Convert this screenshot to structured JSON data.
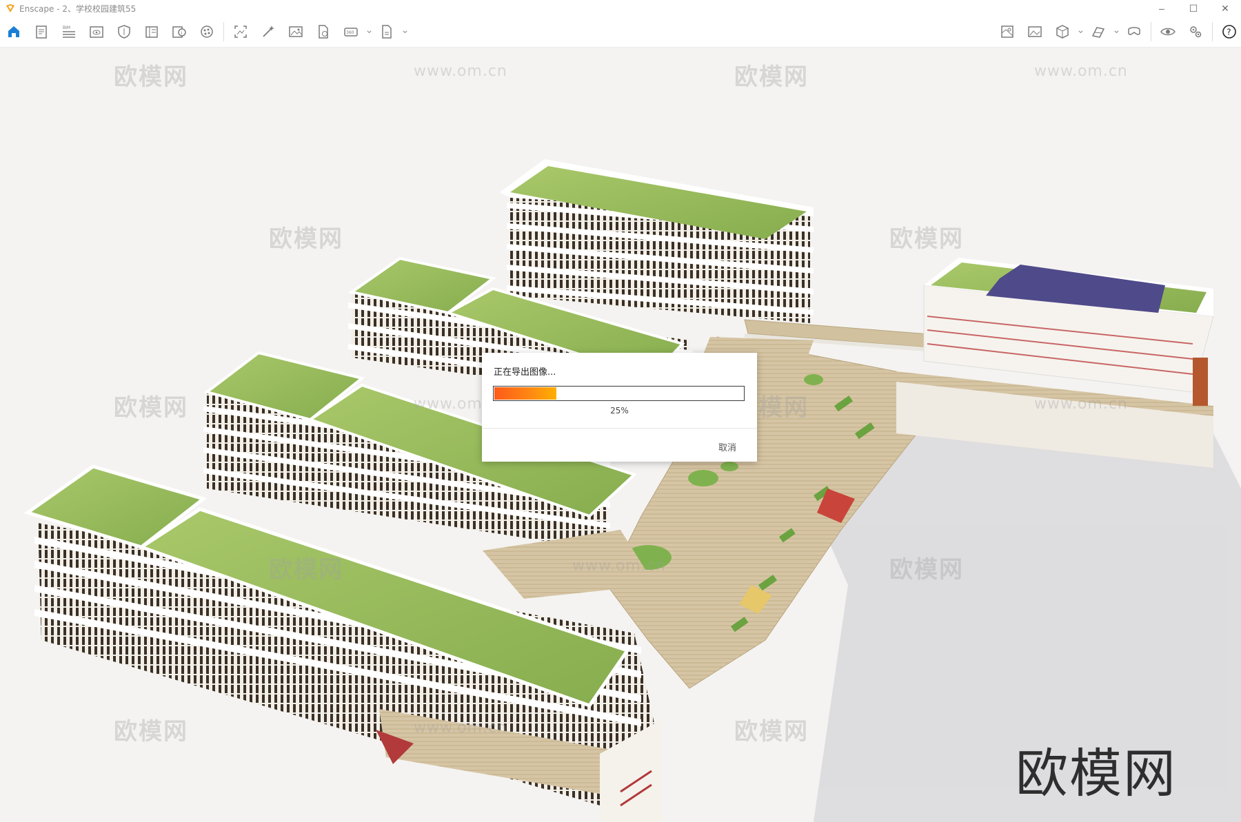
{
  "window": {
    "title": "Enscape - 2、学校校园建筑55",
    "controls": {
      "minimize": "–",
      "maximize": "☐",
      "close": "✕"
    }
  },
  "toolbar": {
    "left_tools": [
      {
        "icon": "home-icon"
      },
      {
        "icon": "document-icon"
      },
      {
        "icon": "bim-icon"
      },
      {
        "icon": "visibility-icon"
      },
      {
        "icon": "shield-icon"
      },
      {
        "icon": "library-icon"
      },
      {
        "icon": "asset-info-icon"
      },
      {
        "icon": "materials-icon"
      },
      {
        "icon": "screenshot-icon"
      },
      {
        "icon": "magic-wand-icon"
      },
      {
        "icon": "image-icon"
      },
      {
        "icon": "export-file-icon"
      },
      {
        "icon": "panorama-360-icon"
      },
      {
        "icon": "file-export-icon"
      }
    ],
    "right_tools": [
      {
        "icon": "map-icon"
      },
      {
        "icon": "gallery-icon"
      },
      {
        "icon": "cube-icon"
      },
      {
        "icon": "section-icon"
      },
      {
        "icon": "vr-headset-icon"
      },
      {
        "icon": "eye-icon"
      },
      {
        "icon": "settings-icon"
      },
      {
        "icon": "help-icon"
      }
    ],
    "accent_color": "#1a7fd4"
  },
  "watermarks": {
    "cn": "欧模网",
    "url": "www.om.cn",
    "brand": "欧模网"
  },
  "dialog": {
    "title": "正在导出图像...",
    "progress": 0.25,
    "progress_label": "25%",
    "cancel_label": "取消"
  }
}
